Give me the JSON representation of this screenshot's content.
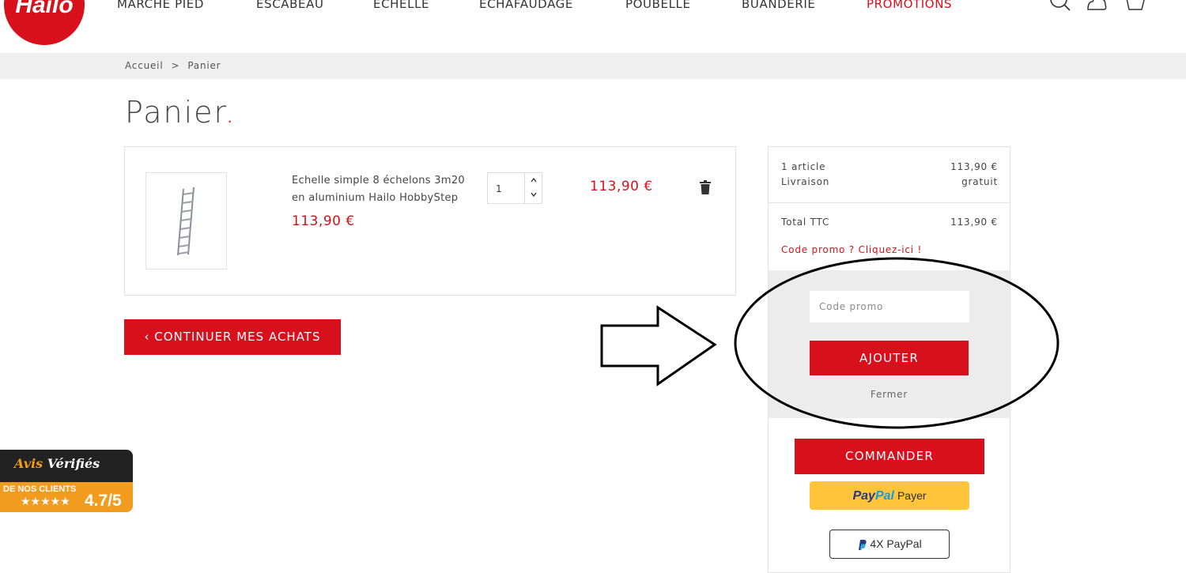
{
  "header": {
    "logo_text": "Hailo",
    "nav": [
      {
        "label": "MARCHE PIED"
      },
      {
        "label": "ESCABEAU"
      },
      {
        "label": "ECHELLE"
      },
      {
        "label": "ECHAFAUDAGE"
      },
      {
        "label": "POUBELLE"
      },
      {
        "label": "BUANDERIE"
      },
      {
        "label": "PROMOTIONS"
      }
    ],
    "icons": [
      "search-icon",
      "account-icon",
      "cart-icon"
    ]
  },
  "breadcrumb": {
    "home": "Accueil",
    "separator": ">",
    "current": "Panier"
  },
  "page": {
    "title": "Panier",
    "title_dot": "."
  },
  "cart": {
    "items": [
      {
        "name": "Echelle simple 8 échelons 3m20 en aluminium Hailo HobbyStep",
        "unit_price": "113,90 €",
        "quantity": "1",
        "line_total": "113,90 €"
      }
    ],
    "continue_label": "CONTINUER MES ACHATS",
    "continue_chevron": "‹"
  },
  "summary": {
    "articles_label": "1 article",
    "articles_value": "113,90 €",
    "delivery_label": "Livraison",
    "delivery_value": "gratuit",
    "total_label": "Total TTC",
    "total_value": "113,90 €",
    "promo_link": "Code promo ? Cliquez-ici !",
    "promo_placeholder": "Code promo",
    "promo_add": "AJOUTER",
    "promo_close": "Fermer",
    "order_button": "COMMANDER",
    "paypal_word1": "Pay",
    "paypal_word2": "Pal",
    "paypal_payer": "Payer",
    "paypal_4x": "4X PayPal"
  },
  "badge": {
    "title_part1": "Avis",
    "title_part2": "Vérifiés",
    "subtitle": "DE NOS CLIENTS",
    "stars": "★★★★★",
    "score": "4.7/5",
    "rating": 4.7
  },
  "colors": {
    "brand_red": "#d7101b",
    "paypal_yellow": "#ffc439",
    "badge_orange": "#f29c1f"
  }
}
